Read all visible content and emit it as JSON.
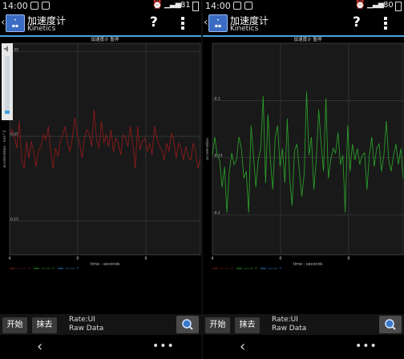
{
  "colors": {
    "accent": "#4aa3e0",
    "accel_x": "#8b1a1a",
    "accel_y": "#2a9a2a",
    "accel_z": "#2a7fd0",
    "plot_bg": "#191919"
  },
  "screens": [
    {
      "status": {
        "time": "14:00",
        "battery": "81"
      },
      "app": {
        "title": "加速度计",
        "subtitle": "Kinetics"
      },
      "chart": {
        "title": "加速度计 暂停"
      },
      "toolbar": {
        "start_label": "开始",
        "clear_label": "抹去",
        "rate_label": "Rate:UI",
        "mode_label": "Raw Data"
      },
      "volume_level": 0.06
    },
    {
      "status": {
        "time": "14:00",
        "battery": "80"
      },
      "app": {
        "title": "加速度计",
        "subtitle": "Kinetics"
      },
      "chart": {
        "title": "加速度计 暂停"
      },
      "toolbar": {
        "start_label": "开始",
        "clear_label": "抹去",
        "rate_label": "Rate:UI",
        "mode_label": "Raw Data"
      }
    }
  ],
  "chart_data": [
    {
      "type": "line",
      "title": "加速度计 暂停",
      "xlabel": "time - seconds",
      "ylabel": "acceleration - m/s^2",
      "x_ticks": [
        "4",
        "6",
        "8"
      ],
      "xlim": [
        4,
        9.6
      ],
      "y_ticks": [
        "0.35",
        "0.25",
        "0.15"
      ],
      "ylim": [
        0.11,
        0.36
      ],
      "legend": [
        "accel_X",
        "accel_Y",
        "accel_Z"
      ],
      "legend_position": "bottom",
      "series": [
        {
          "name": "accel_X",
          "values": [
            0.254,
            0.258,
            0.248,
            0.236,
            0.268,
            0.222,
            0.212,
            0.244,
            0.224,
            0.244,
            0.232,
            0.214,
            0.234,
            0.238,
            0.252,
            0.246,
            0.262,
            0.232,
            0.212,
            0.236,
            0.226,
            0.244,
            0.252,
            0.262,
            0.242,
            0.232,
            0.248,
            0.272,
            0.252,
            0.242,
            0.224,
            0.248,
            0.258,
            0.252,
            0.238,
            0.282,
            0.246,
            0.236,
            0.268,
            0.242,
            0.252,
            0.238,
            0.258,
            0.232,
            0.248,
            0.242,
            0.228,
            0.252,
            0.248,
            0.238,
            0.262,
            0.242,
            0.212,
            0.262,
            0.234,
            0.244,
            0.248,
            0.232,
            0.242,
            0.228,
            0.262,
            0.248,
            0.238,
            0.234,
            0.222,
            0.242,
            0.232,
            0.254,
            0.244,
            0.224,
            0.242,
            0.236,
            0.222,
            0.238,
            0.226,
            0.222,
            0.242,
            0.232,
            0.212,
            0.224
          ]
        }
      ]
    },
    {
      "type": "line",
      "title": "加速度计 暂停",
      "xlabel": "time - seconds",
      "ylabel": "acceleration",
      "x_ticks": [
        "4",
        "6",
        "8"
      ],
      "xlim": [
        4,
        9.6
      ],
      "y_ticks": [
        "-0.1",
        "-0.15",
        "-0.2"
      ],
      "ylim": [
        -0.235,
        -0.05
      ],
      "legend": [
        "accel_X",
        "accel_Y",
        "accel_Z"
      ],
      "legend_position": "bottom",
      "series": [
        {
          "name": "accel_Y",
          "values": [
            -0.148,
            -0.132,
            -0.148,
            -0.152,
            -0.176,
            -0.158,
            -0.198,
            -0.162,
            -0.146,
            -0.156,
            -0.152,
            -0.132,
            -0.142,
            -0.168,
            -0.162,
            -0.198,
            -0.122,
            -0.148,
            -0.176,
            -0.152,
            -0.142,
            -0.096,
            -0.172,
            -0.112,
            -0.152,
            -0.178,
            -0.132,
            -0.122,
            -0.158,
            -0.142,
            -0.172,
            -0.116,
            -0.168,
            -0.192,
            -0.144,
            -0.138,
            -0.162,
            -0.184,
            -0.164,
            -0.092,
            -0.148,
            -0.132,
            -0.178,
            -0.152,
            -0.108,
            -0.138,
            -0.162,
            -0.098,
            -0.168,
            -0.152,
            -0.142,
            -0.146,
            -0.128,
            -0.156,
            -0.148,
            -0.198,
            -0.122,
            -0.162,
            -0.138,
            -0.152,
            -0.142,
            -0.156,
            -0.148,
            -0.146,
            -0.178,
            -0.148,
            -0.132,
            -0.158,
            -0.142,
            -0.138,
            -0.162,
            -0.148,
            -0.118,
            -0.152,
            -0.162,
            -0.148,
            -0.138,
            -0.156,
            -0.142,
            -0.168
          ]
        }
      ]
    }
  ]
}
